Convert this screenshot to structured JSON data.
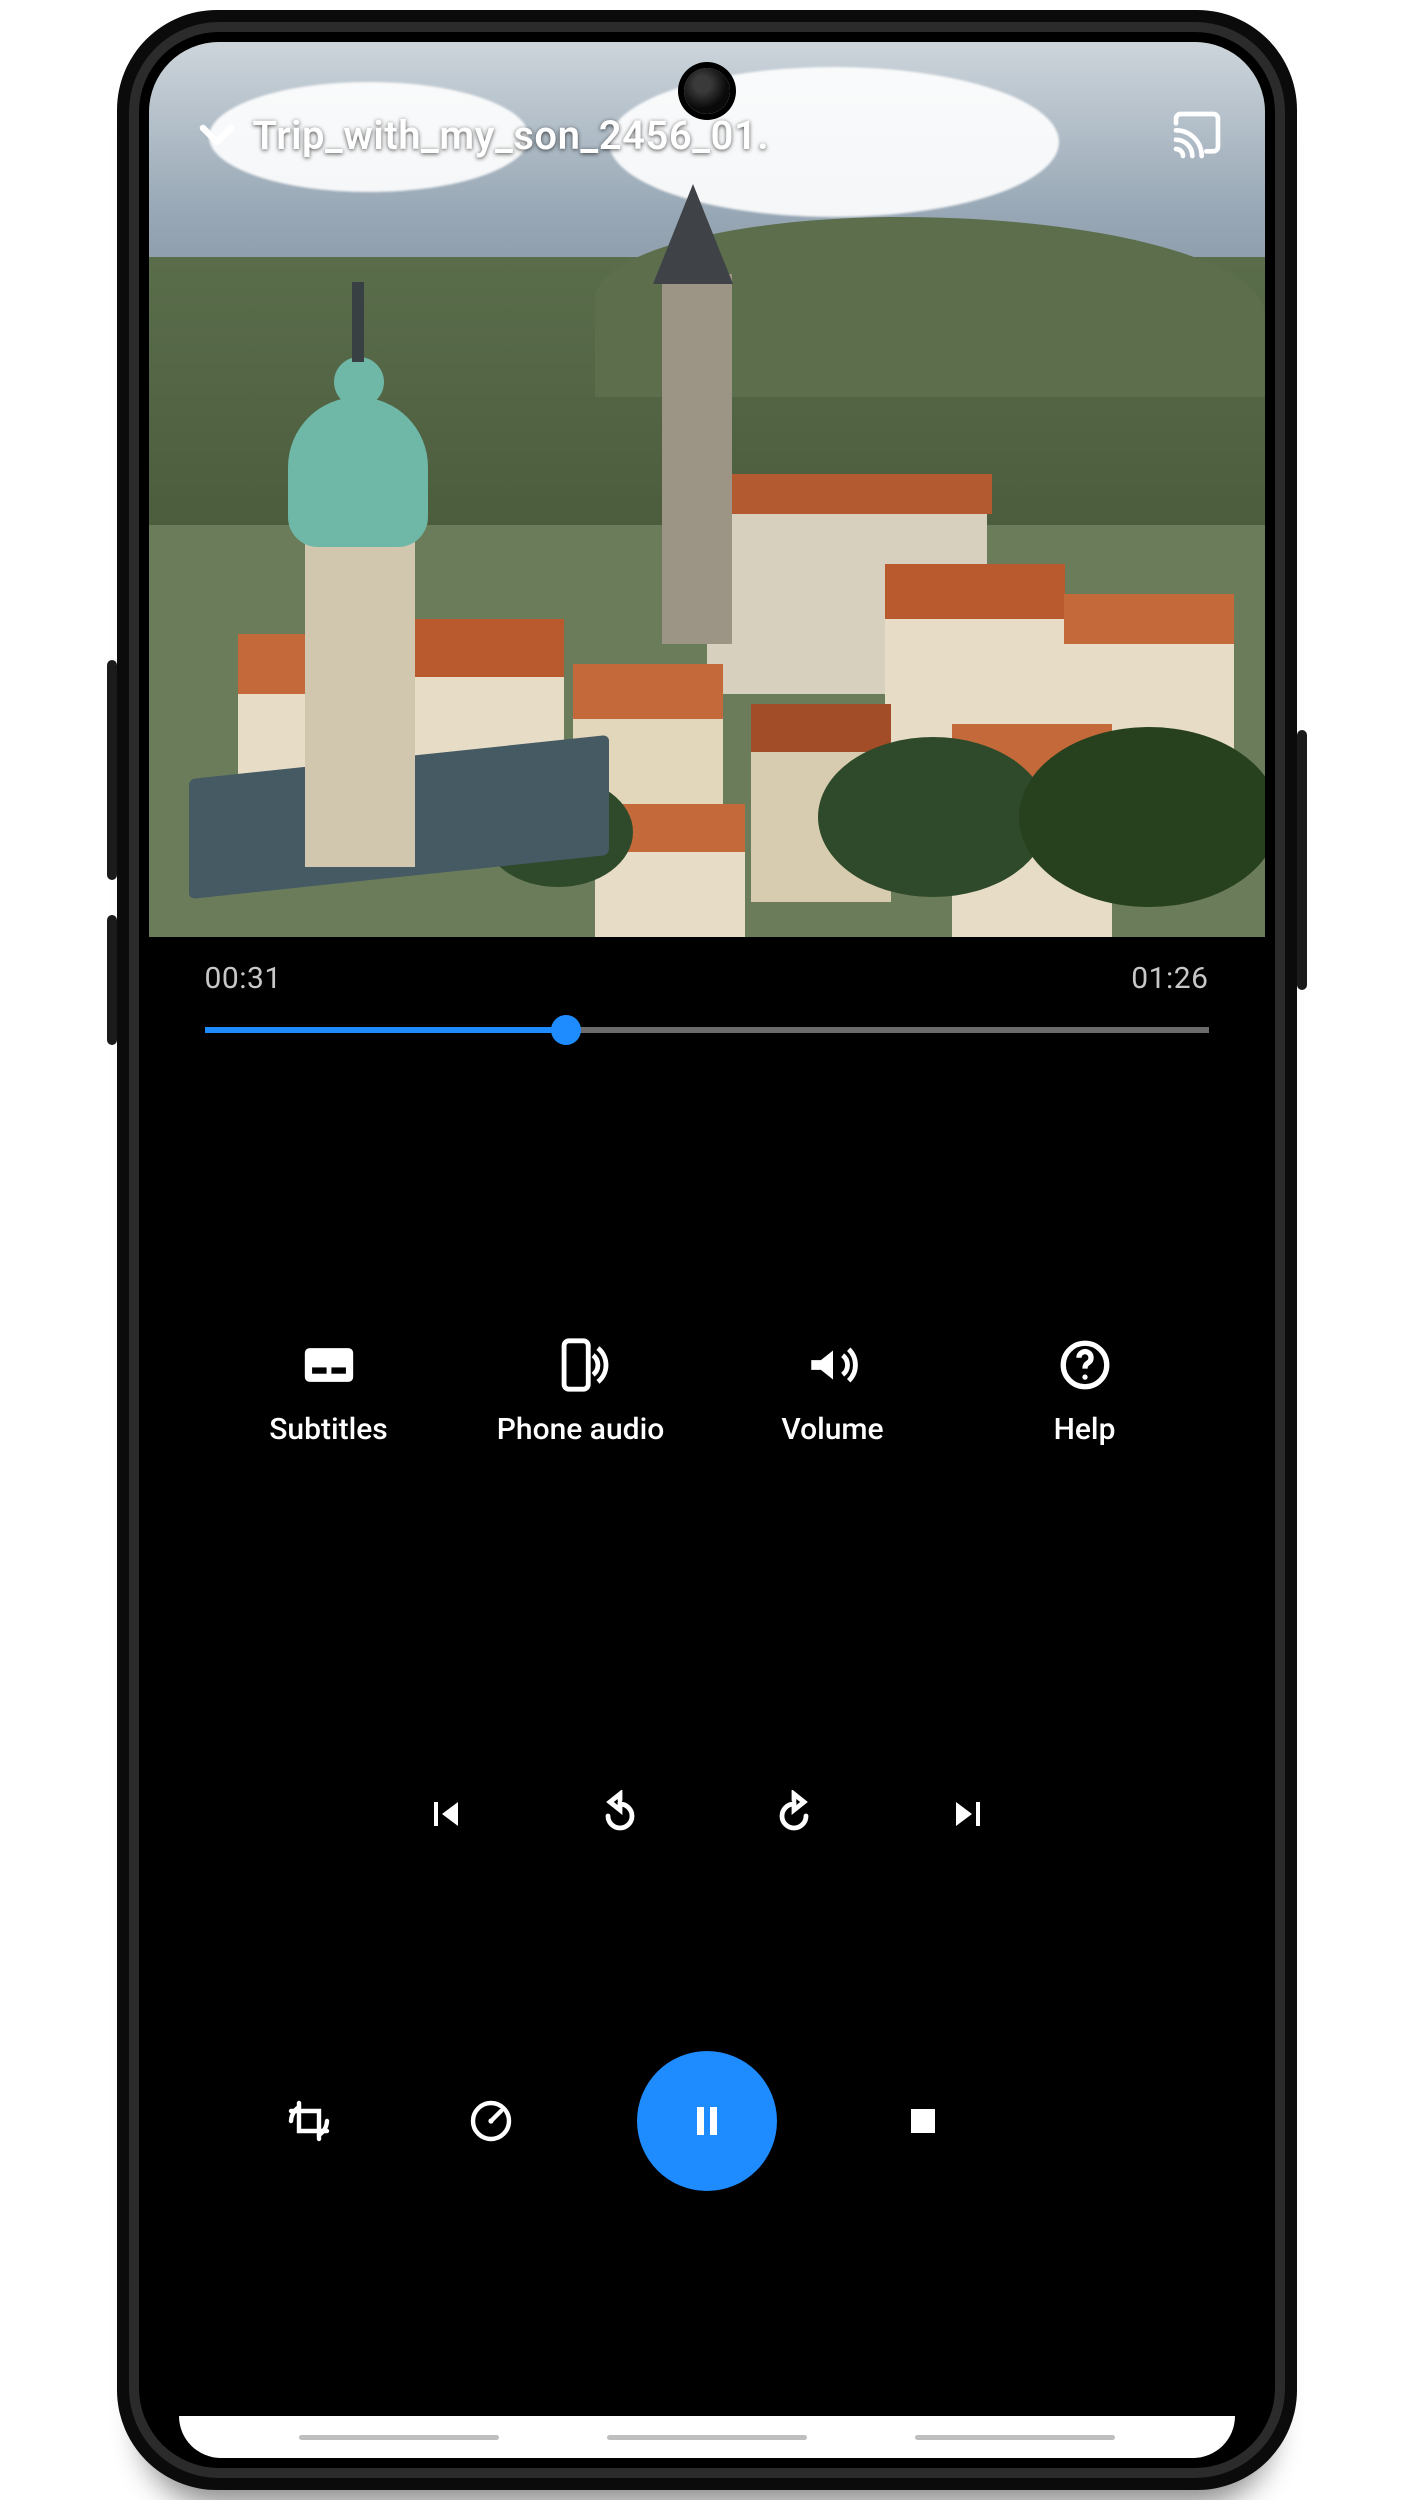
{
  "accent_color": "#1e8bff",
  "header": {
    "title": "Trip_with_my_son_2456_01."
  },
  "playback": {
    "position_label": "00:31",
    "duration_label": "01:26",
    "position_seconds": 31,
    "duration_seconds": 86,
    "progress_percent": 36
  },
  "options": {
    "subtitles": {
      "label": "Subtitles"
    },
    "phone_audio": {
      "label": "Phone audio"
    },
    "volume": {
      "label": "Volume"
    },
    "help": {
      "label": "Help"
    }
  },
  "transport": {
    "prev": "Previous",
    "rewind": "Rewind",
    "forward": "Forward",
    "next": "Next"
  },
  "bottom": {
    "crop_rotate": "Crop & rotate",
    "speed": "Playback speed",
    "pause": "Pause",
    "stop": "Stop"
  }
}
